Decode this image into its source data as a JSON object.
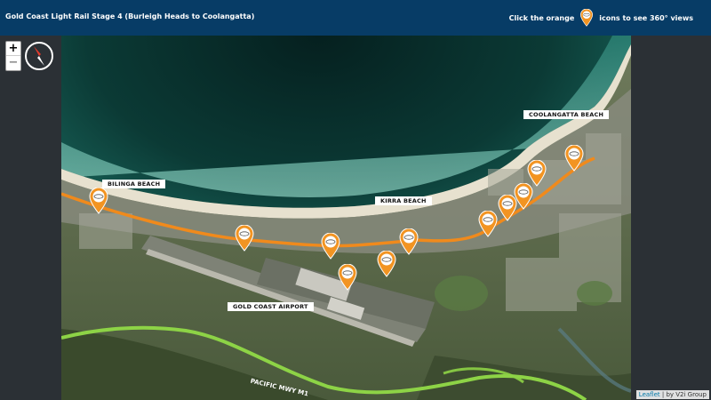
{
  "header": {
    "title": "Gold Coast Light Rail Stage 4 (Burleigh Heads to Coolangatta)",
    "hint_before": "Click the orange",
    "hint_after": "icons to see 360° views"
  },
  "controls": {
    "zoom_in": "+",
    "zoom_out": "−"
  },
  "map": {
    "labels": {
      "bilinga": "BILINGA BEACH",
      "kirra": "KIRRA BEACH",
      "coolangatta": "COOLANGATTA BEACH",
      "airport": "GOLD COAST AIRPORT",
      "highway": "PACIFIC MWY M1"
    },
    "pin_text": "360°",
    "pin_color": "#f29422",
    "route_color": "#f08a1c",
    "highway_color": "#8dd346"
  },
  "attribution": {
    "leaflet": "Leaflet",
    "provider": "| by V2i Group"
  }
}
